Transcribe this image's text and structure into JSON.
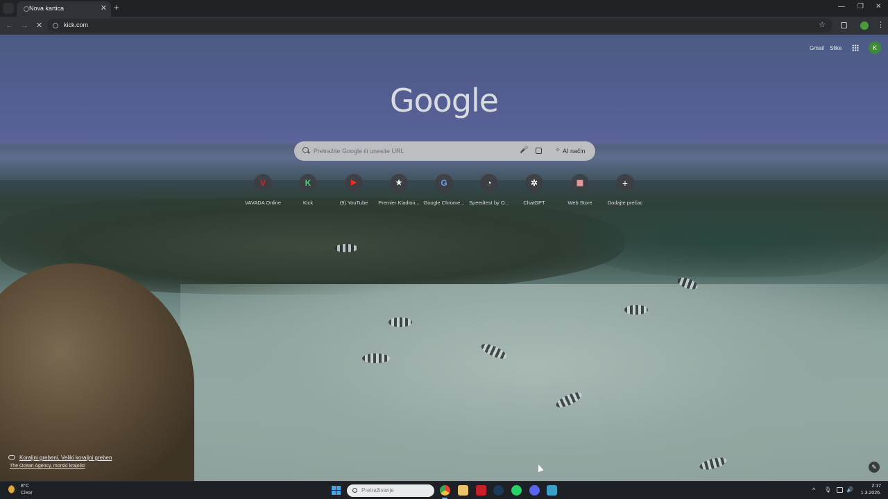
{
  "browser": {
    "tab": {
      "title": "Nova kartica",
      "close_glyph": "✕"
    },
    "new_tab_glyph": "+",
    "window_controls": {
      "minimize": "—",
      "restore": "❐",
      "close": "✕"
    },
    "toolbar": {
      "back_glyph": "←",
      "forward_glyph": "→",
      "reload_glyph": "✕",
      "url": "kick.com",
      "bookmark_glyph": "☆",
      "menu_glyph": "⋮"
    }
  },
  "newtab": {
    "top_links": {
      "gmail": "Gmail",
      "images": "Slike",
      "profile_initial": "K"
    },
    "logo": "Google",
    "search": {
      "placeholder": "Pretražite Google ili unesite URL",
      "ai_mode": "AI način",
      "mic_glyph": "🎤",
      "ai_glyph": "✧"
    },
    "shortcuts": [
      {
        "label": "VAVADA Online",
        "glyph": "V",
        "color": "#c0242a"
      },
      {
        "label": "Kick",
        "glyph": "K",
        "color": "#3bd16f"
      },
      {
        "label": "(9) YouTube",
        "glyph": "▶",
        "color": "#e62117"
      },
      {
        "label": "Premier Kladion...",
        "glyph": "★",
        "color": "#3a3d42"
      },
      {
        "label": "Google Chrome...",
        "glyph": "G",
        "color": "#3a3d42"
      },
      {
        "label": "Speedtest by O...",
        "glyph": "◔",
        "color": "#2a2d31"
      },
      {
        "label": "ChatGPT",
        "glyph": "✲",
        "color": "#3a3d42"
      },
      {
        "label": "Web Store",
        "glyph": "▦",
        "color": "#3a3d42"
      },
      {
        "label": "Dodajte prečac",
        "glyph": "+",
        "color": "#3a3d42"
      }
    ],
    "attribution": {
      "title": "Koraljni grebeni, Veliki koraljni greben",
      "subtitle": "The Ocean Agency, morski krajolici"
    },
    "customize_glyph": "✎"
  },
  "taskbar": {
    "weather": {
      "temp": "8°C",
      "condition": "Clear"
    },
    "search_placeholder": "Pretraživanje",
    "apps": [
      {
        "name": "chrome-icon",
        "color": "#e8a33a"
      },
      {
        "name": "file-explorer-icon",
        "color": "#e9c46a"
      },
      {
        "name": "flash-app-icon",
        "color": "#c8202a"
      },
      {
        "name": "steam-icon",
        "color": "#1b3a5a"
      },
      {
        "name": "whatsapp-icon",
        "color": "#25d366"
      },
      {
        "name": "discord-icon",
        "color": "#5865f2"
      },
      {
        "name": "notepad-icon",
        "color": "#3aa0c8"
      }
    ],
    "tray": {
      "chevron": "^",
      "mic": "🎙",
      "volume": "🔊"
    },
    "clock": {
      "time": "2:17",
      "date": "1.3.2026."
    }
  }
}
